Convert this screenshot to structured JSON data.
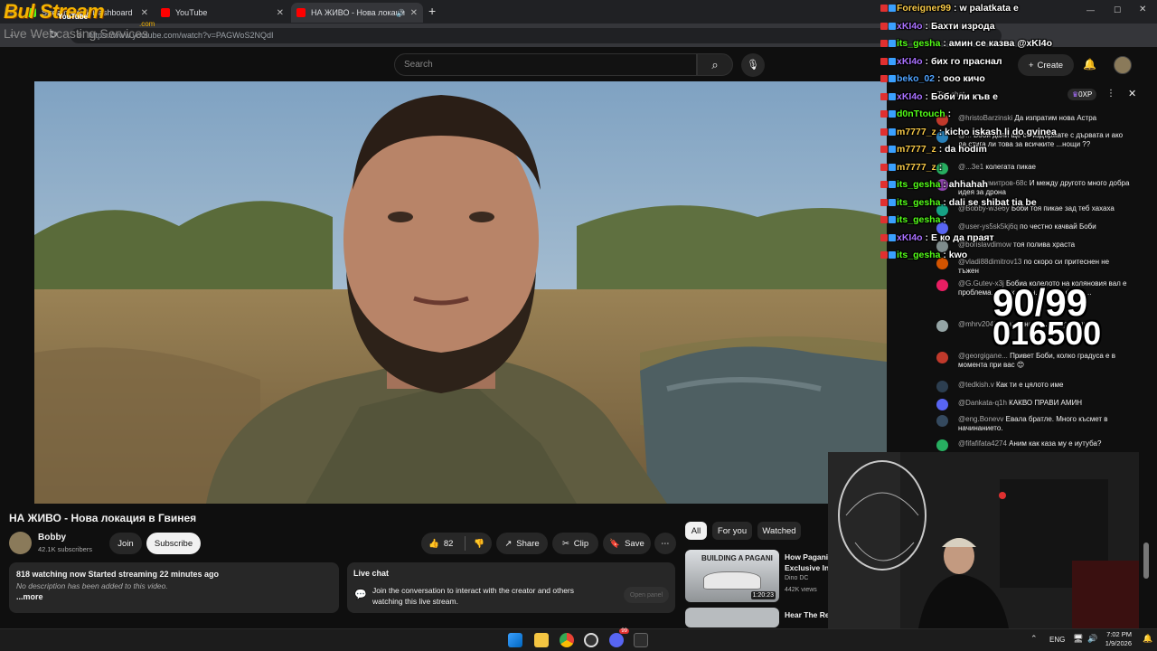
{
  "browser": {
    "tabs": [
      {
        "title": "Stream - Kick Dashboard",
        "color": "#53fc18"
      },
      {
        "title": "YouTube",
        "color": "#ff0000"
      },
      {
        "title": "НА ЖИВО - Нова локаци",
        "color": "#ff0000"
      }
    ],
    "url": "https://www.youtube.com/watch?v=PAGWoS2NQdI"
  },
  "overlay": {
    "logo_text": "Bul Stream",
    "logo_sub": "Live Webcasting Services",
    "logo_badge": "YouTube",
    "logo_com": ".com",
    "counter_top": "90/99",
    "counter_bottom": "016500"
  },
  "youtube": {
    "search_placeholder": "Search",
    "create_label": "Create",
    "video_title": "НА ЖИВО - Нова локация в Гвинея",
    "channel_name": "Bobby",
    "subscribers": "42.1K subscribers",
    "join_label": "Join",
    "subscribe_label": "Subscribe",
    "likes": "82",
    "share_label": "Share",
    "clip_label": "Clip",
    "save_label": "Save",
    "filter_all": "All",
    "filter_foryou": "For you",
    "filter_watched": "Watched",
    "watching": "818 watching now  Started streaming 22 minutes ago",
    "no_desc": "No description has been added to this video.",
    "more": "...more",
    "livechat_title": "Live chat",
    "livechat_text": "Join the conversation to interact with the creator and others watching this live stream.",
    "open_panel": "Open panel",
    "side1_title": "How Pagani",
    "side1_title2": "Exclusive Ins",
    "side1_channel": "Dino DC",
    "side1_views": "442K views",
    "side1_duration": "1:20:23",
    "side1_thumb_text": "BUILDING A PAGANI",
    "side2_title": "Hear The Re"
  },
  "ytchat": {
    "top_chat": "Top chat",
    "xp": "0XP",
    "messages": [
      {
        "user": "@hristoBarzinski",
        "text": "Да изпратим нова Астра",
        "color": "#c0392b"
      },
      {
        "user": "@...",
        "text": "Боби дали ще се издържате с дървата и ако да стига ли това за всичките ...нощи ??",
        "color": "#2980b9"
      },
      {
        "user": "@...3e1",
        "text": "колегата пикае",
        "color": "#27ae60"
      },
      {
        "user": "@...ърДимитров-68c",
        "text": "И между другото много добра идея за дрона",
        "color": "#8e44ad"
      },
      {
        "user": "@Bobby-w3e6y",
        "text": "Боби тоя пикае зад теб хахаха",
        "color": "#16a085"
      },
      {
        "user": "@user-ys5sk5kj6q",
        "text": "по честно качвай Боби",
        "color": "#5865f2"
      },
      {
        "user": "@borislavdimow",
        "text": "тоя полива храста",
        "color": "#7f8c8d"
      },
      {
        "user": "@vladi88dimitrov13",
        "text": "по скоро си притеснен не тъжен",
        "color": "#d35400"
      },
      {
        "user": "@G.Gutev-x3j",
        "text": "Бобиа колелото на коляновия вал е проблема... праха и т.н. ... дава фира ...",
        "color": "#e91e63"
      },
      {
        "user": "@mhrv2049",
        "text": "...ангренажа ... неправилн...",
        "color": "#95a5a6"
      },
      {
        "user": "@georgigane...",
        "text": "Привет Боби, колко градуса е в момента при вас 😊",
        "color": "#c0392b"
      },
      {
        "user": "@tedkish.v",
        "text": "Как ти е цялото име",
        "color": "#2c3e50"
      },
      {
        "user": "@Dankata-q1h",
        "text": "КАКВО ПРАВИ АМИН",
        "color": "#5865f2"
      },
      {
        "user": "@eng.Bonevv",
        "text": "Евала братле. Много късмет в начинанието.",
        "color": "#34495e"
      },
      {
        "user": "@fifafifata4274",
        "text": "Аним как каза му е иутуба?",
        "color": "#27ae60"
      }
    ]
  },
  "kickchat": [
    {
      "user": "Foreigner99",
      "text": "w palatkata e",
      "color": "#f7c948"
    },
    {
      "user": "xKI4o",
      "text": "Бахти изрода",
      "color": "#a970ff"
    },
    {
      "user": "its_gesha",
      "text": "амин се казва @xKI4o",
      "color": "#53fc18"
    },
    {
      "user": "xKI4o",
      "text": "бих го праснал",
      "color": "#a970ff"
    },
    {
      "user": "beko_02",
      "text": "ооо кичо",
      "color": "#4fa3ff"
    },
    {
      "user": "xKI4o",
      "text": "Боби ли къв е",
      "color": "#a970ff"
    },
    {
      "user": "d0nTtouch",
      "text": "",
      "color": "#53fc18"
    },
    {
      "user": "m7777_z",
      "text": "kicho iskash li do gvinea",
      "color": "#f7c948"
    },
    {
      "user": "m7777_z",
      "text": "da hodim",
      "color": "#f7c948"
    },
    {
      "user": "m7777_z",
      "text": "",
      "color": "#f7c948"
    },
    {
      "user": "its_gesha",
      "text": "ahhahah",
      "color": "#53fc18"
    },
    {
      "user": "its_gesha",
      "text": "dali se shibat tia be",
      "color": "#53fc18"
    },
    {
      "user": "its_gesha",
      "text": "",
      "color": "#53fc18"
    },
    {
      "user": "xKI4o",
      "text": "E ко да праят",
      "color": "#a970ff"
    },
    {
      "user": "its_gesha",
      "text": "kwo",
      "color": "#53fc18"
    }
  ],
  "taskbar": {
    "lang": "ENG",
    "time": "7:02 PM",
    "date": "1/9/2026",
    "discord_badge": "99"
  }
}
